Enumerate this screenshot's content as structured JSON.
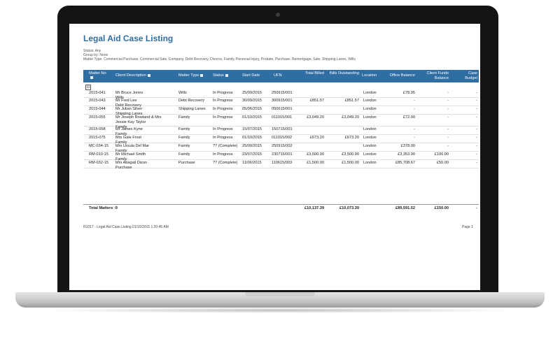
{
  "report": {
    "title": "Legal Aid Case Listing",
    "status_line": "Status: Any",
    "group_line": "Group by: None",
    "matter_type_line": "Matter Type: Commercial Purchase, Commercial Sale, Company, Debt Recovery, Divorce, Family, Personal Injury, Probate, Purchase, Remortgage, Sale, Shipping Lanes, Wills",
    "group_toggle": "⊟"
  },
  "columns": [
    "Matter No",
    "Client Description",
    "Matter Type",
    "Status",
    "Start Date",
    "UFN",
    "Total Billed",
    "Bills Outstanding",
    "Location",
    "Office Balance",
    "Client Funds Balance",
    "Case Budget"
  ],
  "rows": [
    {
      "matter_no": "2015-041",
      "client": [
        "Mr Bruce Jones",
        "Wills"
      ],
      "type": "Wills",
      "status": "In Progress",
      "start": "25/09/2015",
      "ufn": "250915/001",
      "billed": "",
      "outstanding": "",
      "location": "London",
      "office": "£78.95",
      "client_funds": "-",
      "budget": "-"
    },
    {
      "matter_no": "2015-043",
      "client": [
        "Mr Fred Lee",
        "Debt Recovery"
      ],
      "type": "Debt Recovery",
      "status": "In Progress",
      "start": "30/09/2015",
      "ufn": "300915/001",
      "billed": "£851.57",
      "outstanding": "£851.57",
      "location": "London",
      "office": "-",
      "client_funds": "-",
      "budget": "-"
    },
    {
      "matter_no": "2015-044",
      "client": [
        "Mr Julian Silver",
        "Shipping Lanes"
      ],
      "type": "Shipping Lanes",
      "status": "In Progress",
      "start": "05/06/2015",
      "ufn": "050615/001",
      "billed": "",
      "outstanding": "",
      "location": "London",
      "office": "-",
      "client_funds": "-",
      "budget": "-"
    },
    {
      "matter_no": "2015-055",
      "client": [
        "Mr Joseph Rowland & Mrs",
        "Jessie Kay Taylor",
        "Family"
      ],
      "type": "Family",
      "status": "In Progress",
      "start": "01/10/2015",
      "ufn": "011015/001",
      "billed": "£3,049.20",
      "outstanding": "£3,049.20",
      "location": "London",
      "office": "£72.00",
      "client_funds": "-",
      "budget": "-"
    },
    {
      "matter_no": "2015-058",
      "client": [
        "Mr James Kyne",
        "Family"
      ],
      "type": "Family",
      "status": "In Progress",
      "start": "15/07/2015",
      "ufn": "150715/001",
      "billed": "",
      "outstanding": "",
      "location": "London",
      "office": "-",
      "client_funds": "-",
      "budget": "-"
    },
    {
      "matter_no": "2015-075",
      "client": [
        "Mrs Gale Frost",
        "Family"
      ],
      "type": "Family",
      "status": "In Progress",
      "start": "01/10/2015",
      "ufn": "011015/002",
      "billed": "£673.20",
      "outstanding": "£673.20",
      "location": "London",
      "office": "-",
      "client_funds": "-",
      "budget": "-"
    },
    {
      "matter_no": "MC-034-15",
      "client": [
        "Mrs Ursula Del Mar",
        "Family"
      ],
      "type": "Family",
      "status": "?? (Complete)",
      "start": "25/09/2015",
      "ufn": "250915/002",
      "billed": "",
      "outstanding": "",
      "location": "London",
      "office": "£378.00",
      "client_funds": "-",
      "budget": "-"
    },
    {
      "matter_no": "RM-010-15",
      "client": [
        "Mr Michael Smith",
        "Family"
      ],
      "type": "Family",
      "status": "In Progress",
      "start": "23/07/2015",
      "ufn": "230715/001",
      "billed": "£3,500.00",
      "outstanding": "£3,500.00",
      "location": "London",
      "office": "£3,353.90",
      "client_funds": "£100.00",
      "budget": "-"
    },
    {
      "matter_no": "RM-032-15",
      "client": [
        "Mrs Abagail Dizon",
        "Purchase"
      ],
      "type": "Purchase",
      "status": "?? (Complete)",
      "start": "11/06/2015",
      "ufn": "110615/003",
      "billed": "£1,500.00",
      "outstanding": "£1,500.00",
      "location": "London",
      "office": "£85,708.67",
      "client_funds": "£50.00",
      "budget": "-"
    }
  ],
  "totals": {
    "label": "Total Matters :9",
    "billed": "£10,137.39",
    "outstanding": "£10,073.39",
    "office": "£89,591.52",
    "client_funds": "£150.00",
    "budget": "-"
  },
  "footer": {
    "left": "R1017 - Legal Aid Case Listing 01/10/2015 1:20:45 AM",
    "page": "Page 1"
  }
}
